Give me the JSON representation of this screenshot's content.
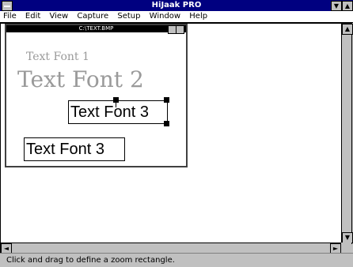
{
  "app": {
    "title": "HiJaak PRO"
  },
  "menu": {
    "items": [
      "File",
      "Edit",
      "View",
      "Capture",
      "Setup",
      "Window",
      "Help"
    ]
  },
  "child": {
    "title": "C:\\TEXT.BMP"
  },
  "canvas": {
    "text_font_1": "Text Font 1",
    "text_font_2": "Text Font 2",
    "text_font_3_selected": "Text Font 3",
    "text_font_3": "Text Font 3"
  },
  "status": {
    "text": "Click and drag to define a zoom rectangle."
  },
  "colors": {
    "title_bar": "#000080",
    "desktop": "#c0c0c0",
    "canvas": "#ffffff"
  }
}
